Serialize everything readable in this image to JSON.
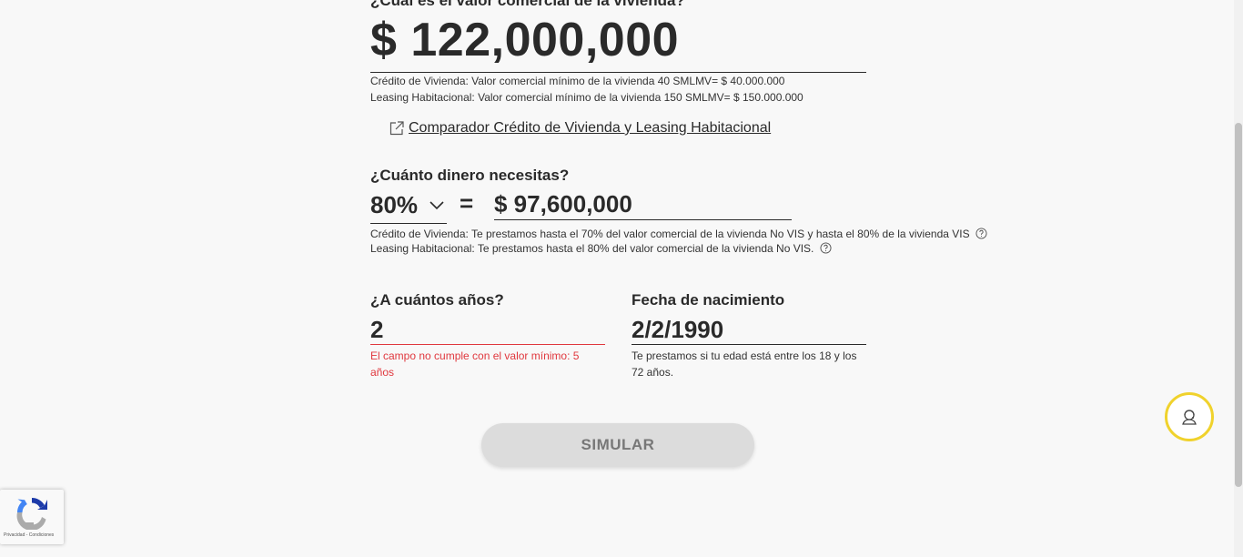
{
  "property": {
    "question": "¿Cuál es el valor comercial de la vivienda?",
    "value": "$ 122,000,000",
    "note_credito": "Crédito de Vivienda: Valor comercial mínimo de la vivienda 40 SMLMV= $ 40.000.000",
    "note_leasing": "Leasing Habitacional: Valor comercial mínimo de la vivienda 150 SMLMV= $ 150.000.000",
    "comparator_link": " Comparador Crédito de Vivienda y Leasing Habitacional"
  },
  "loan": {
    "question": "¿Cuánto dinero necesitas?",
    "percentage": "80%",
    "equals": "=",
    "amount": "$ 97,600,000",
    "note_credito": "Crédito de Vivienda: Te prestamos hasta el 70% del valor comercial de la vivienda No VIS y hasta el 80% de la vivienda VIS",
    "note_leasing": "Leasing Habitacional: Te prestamos hasta el 80% del valor comercial de la vivienda No VIS."
  },
  "term": {
    "label": "¿A cuántos años?",
    "value": "2",
    "error": "El campo no cumple con el valor mínimo: 5 años"
  },
  "birth": {
    "label": "Fecha de nacimiento",
    "value": "2/2/1990",
    "hint": "Te prestamos si tu edad está entre los 18 y los 72 años."
  },
  "actions": {
    "simulate": "SIMULAR"
  },
  "recaptcha": {
    "footer": "Privacidad - Condiciones"
  },
  "colors": {
    "error": "#e0383e",
    "help_ring": "#f0d22c",
    "button_bg": "#dcdcdc"
  }
}
